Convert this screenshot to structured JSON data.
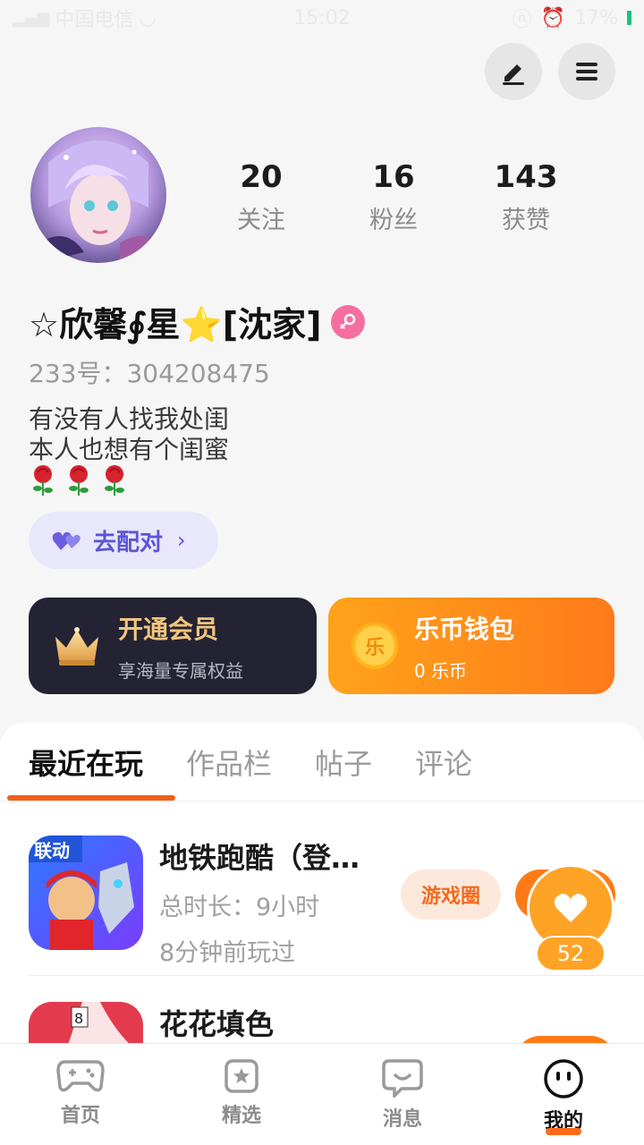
{
  "status_bar": {
    "carrier": "中国电信",
    "time": "15:02",
    "battery": "17%"
  },
  "profile": {
    "stats": [
      {
        "value": "20",
        "label": "关注"
      },
      {
        "value": "16",
        "label": "粉丝"
      },
      {
        "value": "143",
        "label": "获赞"
      }
    ],
    "nickname": "☆欣馨∮星⭐[沈家]",
    "uid": "233号：304208475",
    "bio_line1": "有没有人找我处闺",
    "bio_line2": "本人也想有个闺蜜",
    "match_button": "去配对"
  },
  "cards": {
    "vip": {
      "title": "开通会员",
      "subtitle": "享海量专属权益"
    },
    "wallet": {
      "title": "乐币钱包",
      "subtitle": "0 乐币",
      "coin_glyph": "乐"
    }
  },
  "tabs": [
    "最近在玩",
    "作品栏",
    "帖子",
    "评论"
  ],
  "games": [
    {
      "name": "地铁跑酷（登…",
      "duration": "总时长：9小时",
      "last_played": "8分钟前玩过",
      "pill": "游戏圈",
      "icon_badge": "联动"
    },
    {
      "name": "花花填色",
      "icon_badge": "8"
    }
  ],
  "floating_like": {
    "count": "52"
  },
  "bottom_nav": [
    {
      "label": "首页"
    },
    {
      "label": "精选"
    },
    {
      "label": "消息"
    },
    {
      "label": "我的"
    }
  ],
  "colors": {
    "accent": "#ff7a14",
    "vip_card": "#232334",
    "match_purple": "#5d55d6"
  }
}
